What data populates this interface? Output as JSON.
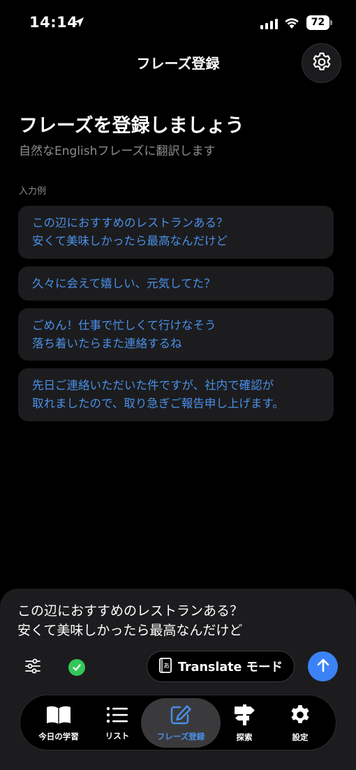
{
  "status_bar": {
    "time": "14:14",
    "battery": "72"
  },
  "header": {
    "title": "フレーズ登録"
  },
  "intro": {
    "title": "フレーズを登録しましょう",
    "subtitle": "自然なEnglishフレーズに翻訳します"
  },
  "examples": {
    "label": "入力例",
    "items": [
      "この辺におすすめのレストランある？\n安くて美味しかったら最高なんだけど",
      "久々に会えて嬉しい、元気してた？",
      "ごめん！仕事で忙しくて行けなそう\n落ち着いたらまた連絡するね",
      "先日ご連絡いただいた件ですが、社内で確認が\n取れましたので、取り急ぎご報告申し上げます。"
    ]
  },
  "composer": {
    "text": "この辺におすすめのレストランある？\n安くて美味しかったら最高なんだけど",
    "mode_label": "Translate モード"
  },
  "tabs": [
    {
      "label": "今日の学習",
      "icon": "book-icon"
    },
    {
      "label": "リスト",
      "icon": "list-icon"
    },
    {
      "label": "フレーズ登録",
      "icon": "edit-icon"
    },
    {
      "label": "探索",
      "icon": "signpost-icon"
    },
    {
      "label": "設定",
      "icon": "gear-icon"
    }
  ],
  "colors": {
    "accent": "#4a90e8",
    "send": "#3b82f6",
    "success": "#34c759",
    "card": "#1c1c1e"
  }
}
